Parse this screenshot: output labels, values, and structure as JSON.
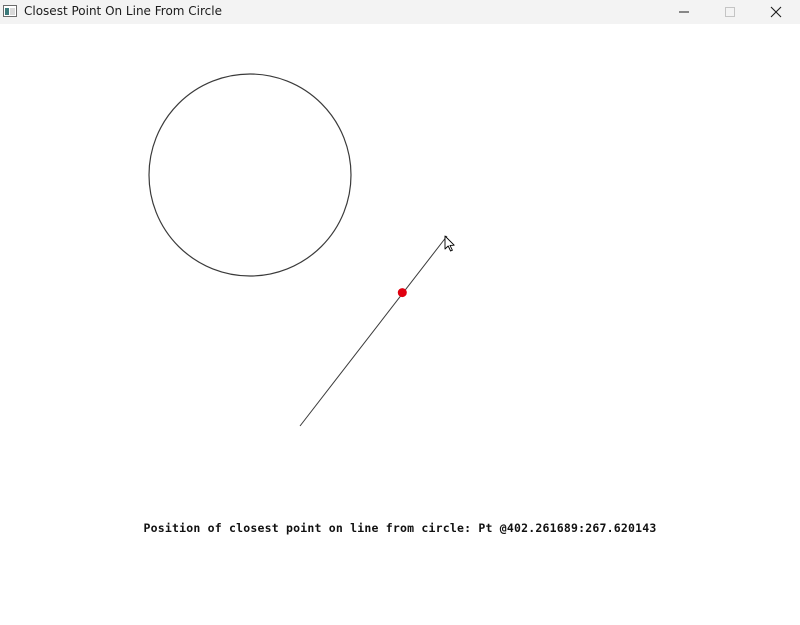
{
  "window": {
    "title": "Closest Point On Line From Circle",
    "controls": {
      "minimize": "minimize-icon",
      "maximize": "maximize-icon",
      "close": "close-icon"
    }
  },
  "scene": {
    "circle_color": "#3a3a3a",
    "line_color": "#3a3a3a",
    "point_color": "#e0000f"
  },
  "status": {
    "text": "Position of closest point on line from circle: Pt @402.261689:267.620143"
  }
}
